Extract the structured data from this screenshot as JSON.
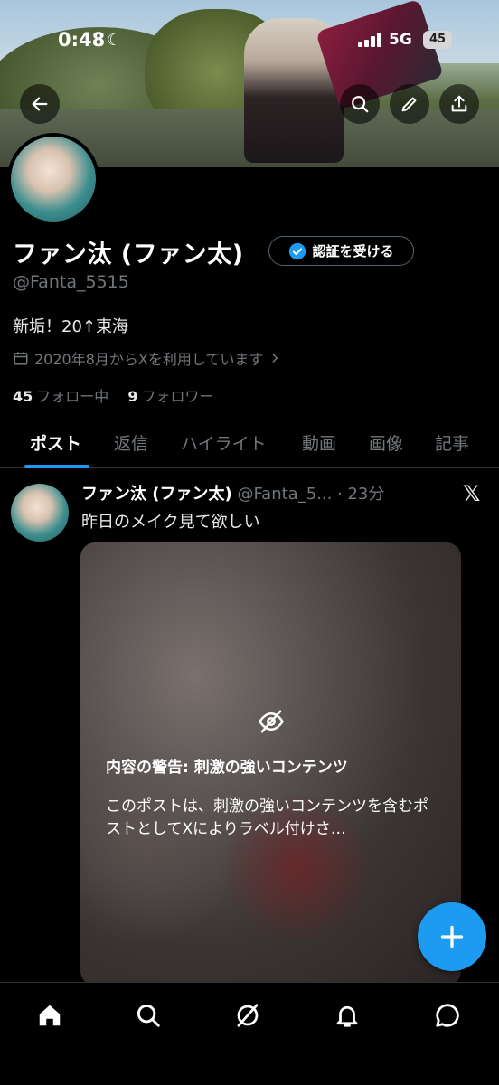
{
  "status_bar": {
    "time": "0:48",
    "network": "5G",
    "battery": "45"
  },
  "header_icons": [
    "back-arrow-icon",
    "search-icon",
    "edit-icon",
    "share-icon"
  ],
  "profile": {
    "name": "ファン汰 (ファン太)",
    "verify_label": "認証を受ける",
    "handle": "@Fanta_5515",
    "bio": "新垢！20↑東海",
    "joined": "2020年8月からXを利用しています",
    "following_count": "45",
    "following_label": "フォロー中",
    "followers_count": "9",
    "followers_label": "フォロワー"
  },
  "tabs": [
    "ポスト",
    "返信",
    "ハイライト",
    "動画",
    "画像",
    "記事"
  ],
  "post": {
    "name": "ファン汰 (ファン太)",
    "meta": "@Fanta_5... · 23分",
    "text": "昨日のメイク見て欲しい",
    "warning_title": "内容の警告: 刺激の強いコンテンツ",
    "warning_body": "このポストは、刺激の強いコンテンツを含むポストとしてXによりラベル付けさ…"
  },
  "fab_label": "+",
  "bottom_nav": [
    "home-icon",
    "search-icon",
    "grok-icon",
    "notifications-icon",
    "messages-icon"
  ],
  "colors": {
    "accent": "#1d9bf0",
    "background": "#000000",
    "muted": "#71767b"
  }
}
